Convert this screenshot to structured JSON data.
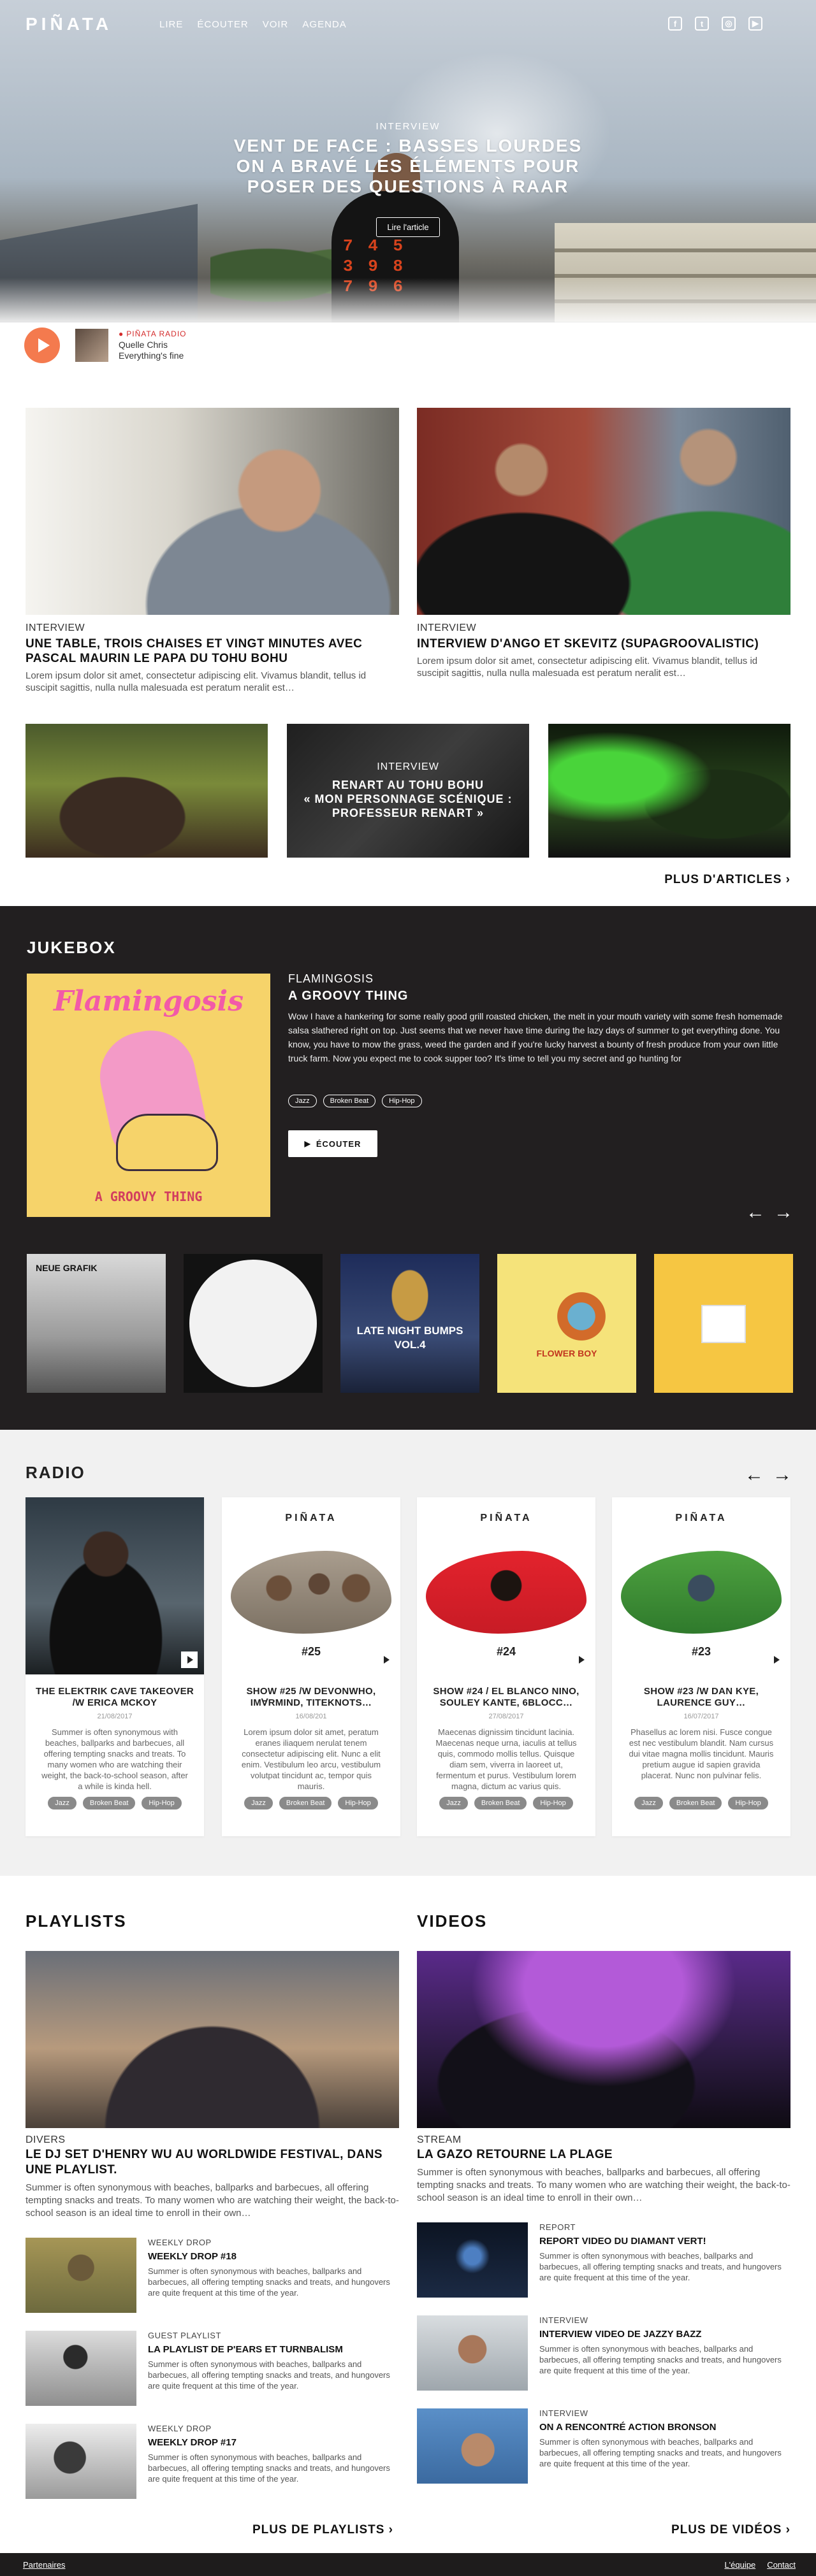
{
  "nav": {
    "logo": "PIÑATA",
    "menu": [
      "LIRE",
      "ÉCOUTER",
      "VOIR",
      "AGENDA"
    ],
    "social": [
      {
        "icon": "facebook-icon",
        "glyph": "f"
      },
      {
        "icon": "twitter-icon",
        "glyph": "t"
      },
      {
        "icon": "instagram-icon",
        "glyph": "◎"
      },
      {
        "icon": "youtube-icon",
        "glyph": "▶"
      }
    ]
  },
  "hero": {
    "kicker": "INTERVIEW",
    "title_lines": [
      "VENT DE FACE : BASSES LOURDES",
      "ON A BRAVÉ LES ÉLÉMENTS POUR",
      "POSER DES QUESTIONS À RAAR"
    ],
    "button": "Lire l'article",
    "shirt_numbers": "7 4 5\n3 9 8\n7 9 6"
  },
  "player": {
    "live_label": "PIÑATA RADIO",
    "host": "Quelle Chris",
    "track": "Everything's fine"
  },
  "articles": {
    "big": [
      {
        "kicker": "INTERVIEW",
        "title": "UNE TABLE, TROIS CHAISES ET VINGT MINUTES AVEC PASCAL MAURIN LE PAPA DU TOHU BOHU",
        "excerpt": "Lorem ipsum dolor sit amet, consectetur adipiscing elit. Vivamus blandit, tellus id suscipit sagittis, nulla nulla malesuada est peratum neralit est…"
      },
      {
        "kicker": "INTERVIEW",
        "title": "INTERVIEW D'ANGO ET SKEVITZ (SUPAGROOVALISTIC)",
        "excerpt": "Lorem ipsum dolor sit amet, consectetur adipiscing elit. Vivamus blandit, tellus id suscipit sagittis, nulla nulla malesuada est peratum neralit est…"
      }
    ],
    "featured_small": {
      "kicker": "INTERVIEW",
      "title_lines": [
        "RENART AU TOHU BOHU",
        "« MON PERSONNAGE SCÉNIQUE :",
        "PROFESSEUR RENART »"
      ]
    },
    "more": "PLUS D'ARTICLES"
  },
  "jukebox": {
    "title": "JUKEBOX",
    "cover_title": "Flamingosis",
    "cover_sub": "A GROOVY THING",
    "artist": "FLAMINGOSIS",
    "album": "A GROOVY THING",
    "description": "Wow I have a hankering for some really good grill roasted chicken, the melt in your mouth variety with some fresh homemade salsa slathered right on top. Just seems that we never have time during the lazy days of summer to get everything done. You know, you have to mow the grass, weed the garden and if you're lucky harvest a bounty of fresh produce from your own little truck farm. Now you expect me to cook supper too? It's time to tell you my secret and go hunting for",
    "tags": [
      "Jazz",
      "Broken Beat",
      "Hip-Hop"
    ],
    "listen": "ÉCOUTER",
    "grid": [
      {
        "label": "NEUE GRAFIK"
      },
      {
        "label": ""
      },
      {
        "label": "LATE NIGHT BUMPS VOL.4"
      },
      {
        "label": "FLOWER BOY"
      },
      {
        "label": ""
      }
    ]
  },
  "radio": {
    "title": "RADIO",
    "logo": "PIÑATA",
    "cards": [
      {
        "title": "THE ELEKTRIK CAVE TAKEOVER /W ERICA MCKOY",
        "date": "21/08/2017",
        "text": "Summer is often synonymous with beaches, ballparks and barbecues, all offering tempting snacks and treats. To many women who are watching their weight, the back-to-school season, after a while is kinda hell.",
        "tags": [
          "Jazz",
          "Broken Beat",
          "Hip-Hop"
        ]
      },
      {
        "title": "SHOW #25 /W DEVONWHO, IM∀RMIND, TITEKNOTS…",
        "date": "16/08/201",
        "number": "#25",
        "text": "Lorem ipsum dolor sit amet, peratum eranes iliaquem nerulat tenem consectetur adipiscing elit. Nunc a elit enim. Vestibulum leo arcu, vestibulum volutpat tincidunt ac, tempor quis mauris.",
        "tags": [
          "Jazz",
          "Broken Beat",
          "Hip-Hop"
        ]
      },
      {
        "title": "SHOW #24 / EL BLANCO NINO, SOULEY KANTE, 6BLOCC…",
        "date": "27/08/2017",
        "number": "#24",
        "text": "Maecenas dignissim tincidunt lacinia. Maecenas neque urna, iaculis at tellus quis, commodo mollis tellus. Quisque diam sem, viverra in laoreet ut, fermentum et purus. Vestibulum lorem magna, dictum ac varius quis.",
        "tags": [
          "Jazz",
          "Broken Beat",
          "Hip-Hop"
        ]
      },
      {
        "title": "SHOW #23 /W DAN KYE, LAURENCE GUY…",
        "date": "16/07/2017",
        "number": "#23",
        "text": "Phasellus ac lorem nisi. Fusce congue est nec vestibulum blandit. Nam cursus dui vitae magna mollis tincidunt. Mauris pretium augue id sapien gravida placerat. Nunc non pulvinar felis.",
        "tags": [
          "Jazz",
          "Broken Beat",
          "Hip-Hop"
        ]
      }
    ]
  },
  "playlists": {
    "title": "PLAYLISTS",
    "main": {
      "kicker": "DIVERS",
      "title": "LE DJ SET D'HENRY WU AU WORLDWIDE FESTIVAL, DANS UNE PLAYLIST.",
      "text": "Summer is often synonymous with beaches, ballparks and barbecues, all offering tempting snacks and treats. To many women who are watching their weight, the back-to-school season is an ideal time to enroll in their own…"
    },
    "items": [
      {
        "kicker": "WEEKLY DROP",
        "title": "WEEKLY DROP #18",
        "text": "Summer is often synonymous with beaches, ballparks and barbecues, all offering tempting snacks and treats, and hungovers are quite frequent at this time of the year."
      },
      {
        "kicker": "GUEST PLAYLIST",
        "title": "LA PLAYLIST DE P'EARS ET TURNBALISM",
        "text": "Summer is often synonymous with beaches, ballparks and barbecues, all offering tempting snacks and treats, and hungovers are quite frequent at this time of the year."
      },
      {
        "kicker": "WEEKLY DROP",
        "title": "WEEKLY DROP #17",
        "text": "Summer is often synonymous with beaches, ballparks and barbecues, all offering tempting snacks and treats, and hungovers are quite frequent at this time of the year."
      }
    ],
    "more": "PLUS DE PLAYLISTS"
  },
  "videos": {
    "title": "VIDEOS",
    "main": {
      "kicker": "STREAM",
      "title": "LA GAZO RETOURNE LA PLAGE",
      "text": "Summer is often synonymous with beaches, ballparks and barbecues, all offering tempting snacks and treats. To many women who are watching their weight, the back-to-school season is an ideal time to enroll in their own…"
    },
    "items": [
      {
        "kicker": "REPORT",
        "title": "REPORT VIDEO DU DIAMANT VERT!",
        "text": "Summer is often synonymous with beaches, ballparks and barbecues, all offering tempting snacks and treats, and hungovers are quite frequent at this time of the year."
      },
      {
        "kicker": "INTERVIEW",
        "title": "INTERVIEW VIDEO DE JAZZY BAZZ",
        "text": "Summer is often synonymous with beaches, ballparks and barbecues, all offering tempting snacks and treats, and hungovers are quite frequent at this time of the year."
      },
      {
        "kicker": "INTERVIEW",
        "title": "ON A RENCONTRÉ ACTION BRONSON",
        "text": "Summer is often synonymous with beaches, ballparks and barbecues, all offering tempting snacks and treats, and hungovers are quite frequent at this time of the year."
      }
    ],
    "more": "PLUS DE VIDÉOS"
  },
  "footer": {
    "left": "Partenaires",
    "right": [
      "L'équipe",
      "Contact"
    ]
  }
}
